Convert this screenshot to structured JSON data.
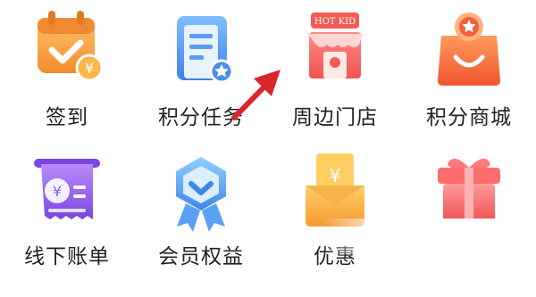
{
  "grid": {
    "items": [
      {
        "label": "签到",
        "icon": "calendar-check-icon"
      },
      {
        "label": "积分任务",
        "icon": "task-list-icon"
      },
      {
        "label": "周边门店",
        "icon": "store-icon",
        "store_sign": "HOT KID"
      },
      {
        "label": "积分商城",
        "icon": "shopping-bag-icon"
      },
      {
        "label": "线下账单",
        "icon": "bill-icon",
        "currency": "¥"
      },
      {
        "label": "会员权益",
        "icon": "badge-check-icon"
      },
      {
        "label": "优惠",
        "icon": "coupon-icon",
        "currency": "¥"
      },
      {
        "label": "",
        "icon": "gift-box-icon"
      }
    ]
  },
  "colors": {
    "orange": "#F5A14A",
    "blue": "#4A8DF0",
    "red": "#F25C54",
    "purple": "#8E5CE8",
    "arrow": "#D9262B"
  }
}
